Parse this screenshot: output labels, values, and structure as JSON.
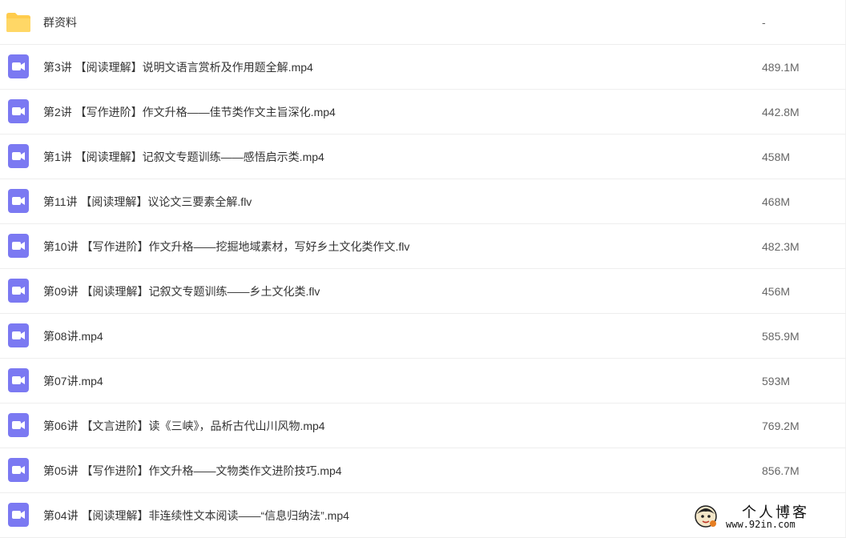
{
  "files": [
    {
      "name": "群资料",
      "size": "-",
      "type": "folder"
    },
    {
      "name": "第3讲 【阅读理解】说明文语言赏析及作用题全解.mp4",
      "size": "489.1M",
      "type": "video"
    },
    {
      "name": "第2讲 【写作进阶】作文升格——佳节类作文主旨深化.mp4",
      "size": "442.8M",
      "type": "video"
    },
    {
      "name": "第1讲 【阅读理解】记叙文专题训练——感悟启示类.mp4",
      "size": "458M",
      "type": "video"
    },
    {
      "name": "第11讲 【阅读理解】议论文三要素全解.flv",
      "size": "468M",
      "type": "video"
    },
    {
      "name": "第10讲 【写作进阶】作文升格——挖掘地域素材，写好乡土文化类作文.flv",
      "size": "482.3M",
      "type": "video"
    },
    {
      "name": "第09讲 【阅读理解】记叙文专题训练——乡土文化类.flv",
      "size": "456M",
      "type": "video"
    },
    {
      "name": "第08讲.mp4",
      "size": "585.9M",
      "type": "video"
    },
    {
      "name": "第07讲.mp4",
      "size": "593M",
      "type": "video"
    },
    {
      "name": "第06讲 【文言进阶】读《三峡》，品析古代山川风物.mp4",
      "size": "769.2M",
      "type": "video"
    },
    {
      "name": "第05讲 【写作进阶】作文升格——文物类作文进阶技巧.mp4",
      "size": "856.7M",
      "type": "video"
    },
    {
      "name": "第04讲 【阅读理解】非连续性文本阅读——“信息归纳法”.mp4",
      "size": "",
      "type": "video"
    }
  ],
  "icons": {
    "folder": "folder-icon",
    "video": "video-file-icon"
  },
  "colors": {
    "folder": "#FFCC4D",
    "video": "#7B79F2",
    "text": "#333333",
    "size_text": "#666666",
    "divider": "#EEEEEE"
  },
  "watermark": {
    "title": "个人博客",
    "url": "www.92in.com"
  }
}
